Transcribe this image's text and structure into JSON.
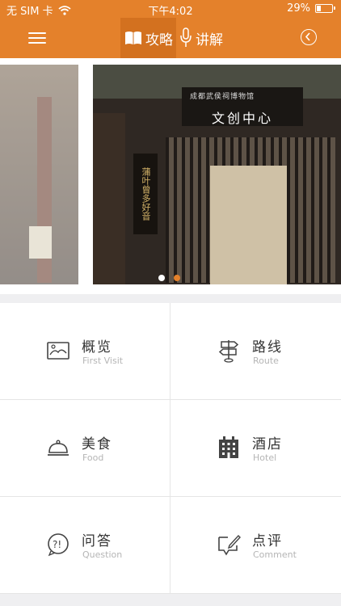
{
  "status_bar": {
    "carrier": "无 SIM 卡",
    "time": "下午4:02",
    "battery": "29%",
    "battery_level": 0.29
  },
  "nav": {
    "tabs": [
      {
        "label": "攻略",
        "icon": "book-icon",
        "active": true
      },
      {
        "label": "讲解",
        "icon": "microphone-icon",
        "active": false
      }
    ],
    "menu_icon": "hamburger-icon",
    "back_icon": "back-circle-icon"
  },
  "banner": {
    "sign_text": "文创中心",
    "sign_small": "成都武侯祠博物馆",
    "scroll_text": "蒲叶曾多好音",
    "dots_count": 2,
    "active_dot": 1
  },
  "menu": [
    {
      "title": "概览",
      "subtitle": "First Visit",
      "icon": "image-icon"
    },
    {
      "title": "路线",
      "subtitle": "Route",
      "icon": "signpost-icon"
    },
    {
      "title": "美食",
      "subtitle": "Food",
      "icon": "food-cloche-icon"
    },
    {
      "title": "酒店",
      "subtitle": "Hotel",
      "icon": "hotel-building-icon"
    },
    {
      "title": "问答",
      "subtitle": "Question",
      "icon": "question-bubble-icon"
    },
    {
      "title": "点评",
      "subtitle": "Comment",
      "icon": "comment-edit-icon"
    }
  ],
  "colors": {
    "accent": "#e4812b",
    "accent_dark": "#d3711f",
    "text": "#333333",
    "subtext": "#b5b5b5",
    "background": "#efeff1"
  }
}
